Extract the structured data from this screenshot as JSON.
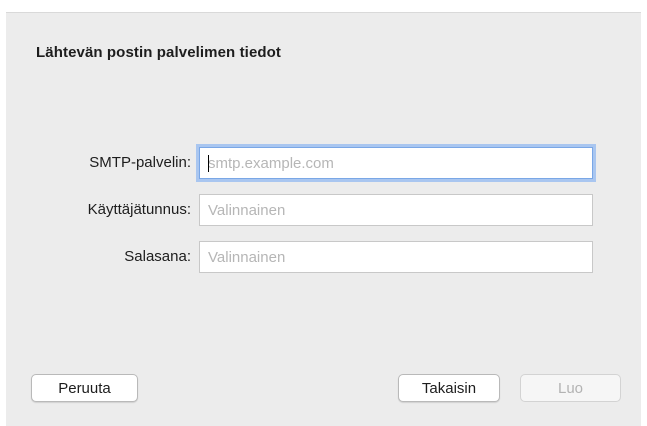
{
  "dialog": {
    "title": "Lähtevän postin palvelimen tiedot"
  },
  "form": {
    "smtp": {
      "label": "SMTP-palvelin:",
      "placeholder": "smtp.example.com",
      "value": ""
    },
    "username": {
      "label": "Käyttäjätunnus:",
      "placeholder": "Valinnainen",
      "value": ""
    },
    "password": {
      "label": "Salasana:",
      "placeholder": "Valinnainen",
      "value": ""
    }
  },
  "buttons": {
    "cancel": "Peruuta",
    "back": "Takaisin",
    "create": "Luo"
  },
  "colors": {
    "window_bg": "#ececec",
    "focus_ring": "#a9c6f0",
    "placeholder": "#b6b6b6"
  }
}
